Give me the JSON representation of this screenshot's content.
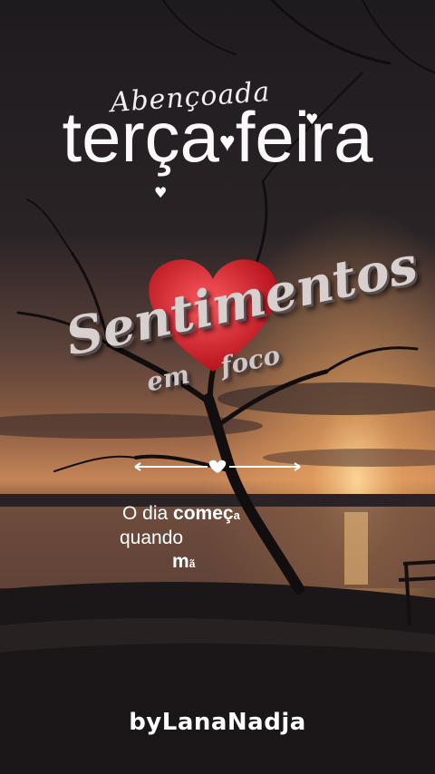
{
  "header": {
    "script_title": "Abençoada",
    "main_word_1": "terça",
    "main_word_2": "feira"
  },
  "logo": {
    "title": "Sentimentos",
    "subtitle_1": "em",
    "subtitle_2": "foco"
  },
  "message": {
    "line1_a": "O dia ",
    "line1_b": "começ",
    "line1_c": "a",
    "line2": "quando",
    "line3_a": "m",
    "line3_b": "ã"
  },
  "footer": {
    "signature": "byLanaNadja"
  },
  "colors": {
    "heart": "#e0313a",
    "text": "#ffffff",
    "sunset": "#f0b27a"
  }
}
